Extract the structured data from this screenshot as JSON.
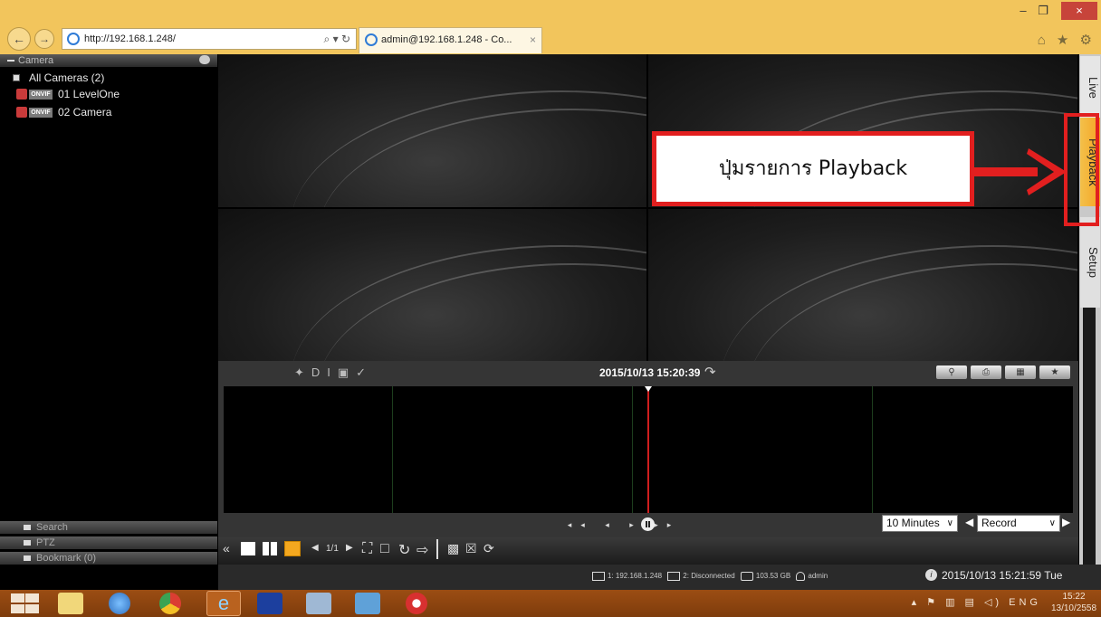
{
  "browser": {
    "url": "http://192.168.1.248/",
    "tab_title": "admin@192.168.1.248 - Co...",
    "tab_close": "×",
    "window_min": "–",
    "window_max": "❐",
    "window_close": "×",
    "addr_tools": "⌕ ▾ ↻",
    "right_icons": "⌂ ★ ⚙"
  },
  "left_panel": {
    "camera_header": "Camera",
    "all_cameras": "All Cameras (2)",
    "cameras": [
      {
        "rec": "REC",
        "onvif": "ONVIF",
        "label": "01  LevelOne"
      },
      {
        "rec": "REC",
        "onvif": "ONVIF",
        "label": "02  Camera"
      }
    ],
    "search": "Search",
    "ptz": "PTZ",
    "bookmark": "Bookmark (0)"
  },
  "side_tabs": {
    "live": "Live",
    "playback": "Playback",
    "setup": "Setup"
  },
  "annotation": {
    "callout": "ปุ่มรายการ Playback",
    "color": "#e21f1f"
  },
  "timeline": {
    "datetime": "2015/10/13 15:20:39",
    "range_select": "10 Minutes",
    "type_select": "Record",
    "play_controls": "◂◂ ◂   ▸ ▸▸"
  },
  "bottom_toolbar": {
    "page_indicator": "1/1",
    "collapse": "«"
  },
  "status": {
    "server1": "1: 192.168.1.248",
    "server2": "2: Disconnected",
    "disk": "103.53 GB",
    "user": "admin",
    "datetime": "2015/10/13 15:21:59 Tue"
  },
  "taskbar": {
    "tray_lang": "ENG",
    "clock_time": "15:22",
    "clock_date": "13/10/2558"
  }
}
